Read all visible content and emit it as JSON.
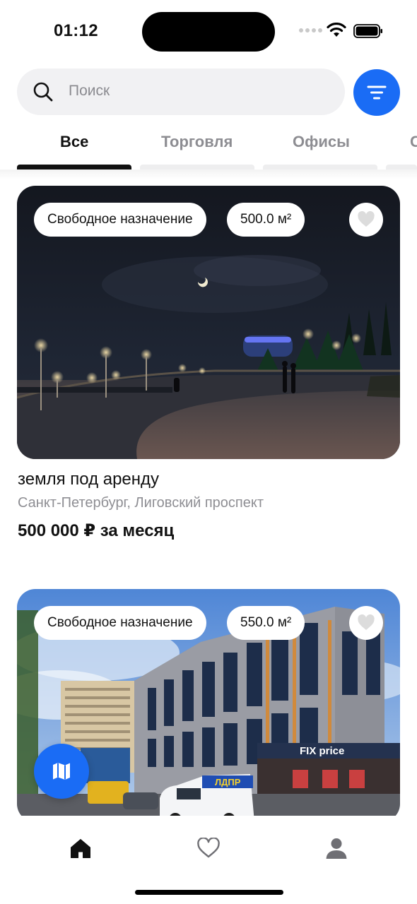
{
  "status_bar": {
    "time": "01:12"
  },
  "search": {
    "placeholder": "Поиск"
  },
  "tabs": [
    {
      "label": "Все",
      "active": true
    },
    {
      "label": "Торговля",
      "active": false
    },
    {
      "label": "Офисы",
      "active": false
    },
    {
      "label": "С",
      "active": false
    }
  ],
  "listings": [
    {
      "purpose": "Свободное назначение",
      "area": "500.0 м²",
      "title": "земля под аренду",
      "address": "Санкт-Петербург, Лиговский проспект",
      "price": "500 000 ₽ за месяц",
      "favorite": false
    },
    {
      "purpose": "Свободное назначение",
      "area": "550.0 м²",
      "favorite": false,
      "photo_texts": [
        "ЛДПР",
        "FIX price"
      ]
    }
  ],
  "icons": {
    "filter": "filter-icon",
    "map": "map-icon",
    "favorite": "heart-icon",
    "nav_home": "home-icon",
    "nav_favorites": "heart-outline-icon",
    "nav_profile": "person-icon"
  },
  "colors": {
    "accent": "#1a6cf5",
    "text_secondary": "#8e8e93",
    "chip_bg": "#ffffff"
  },
  "nav": {
    "active": "home"
  }
}
